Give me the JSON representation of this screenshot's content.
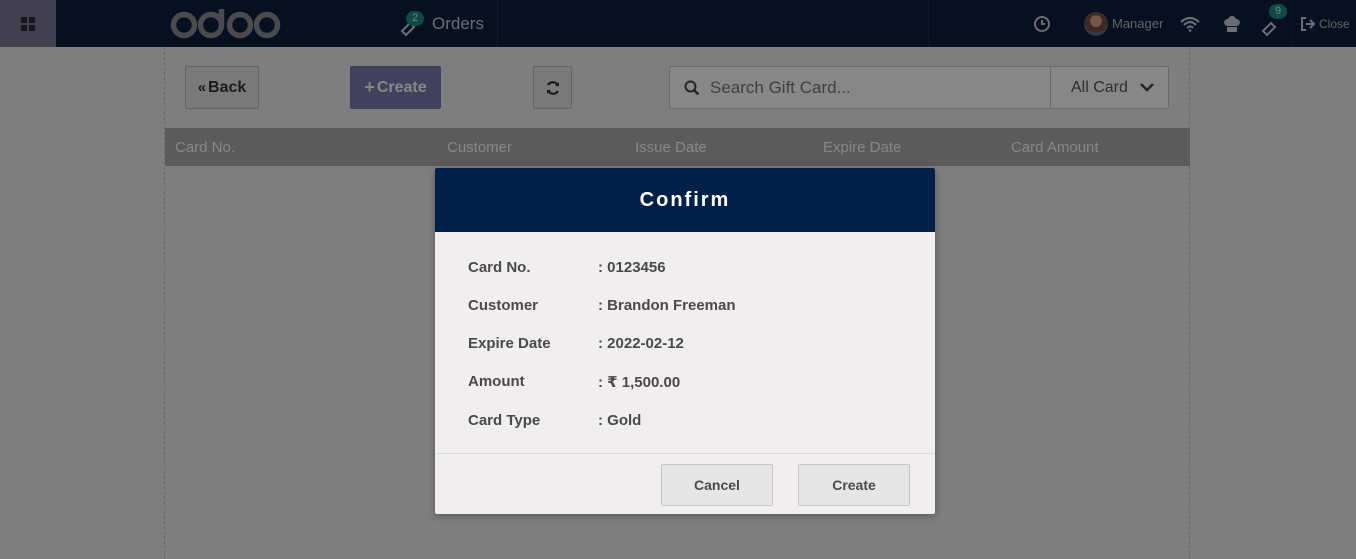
{
  "navbar": {
    "logo_text": "odoo",
    "orders_label": "Orders",
    "orders_badge": "2",
    "manager_label": "Manager",
    "gift_badge": "9",
    "close_label": "Close"
  },
  "toolbar": {
    "back_label": "Back",
    "create_label": "Create",
    "search_placeholder": "Search Gift Card...",
    "filter_selected": "All Card"
  },
  "table": {
    "columns": [
      "Card No.",
      "Customer",
      "Issue Date",
      "Expire Date",
      "Card Amount"
    ]
  },
  "dialog": {
    "title": "Confirm",
    "rows": [
      {
        "label": "Card No.",
        "value": ": 0123456"
      },
      {
        "label": "Customer",
        "value": ": Brandon Freeman"
      },
      {
        "label": "Expire Date",
        "value": ": 2022-02-12"
      },
      {
        "label": "Amount",
        "value": ": ₹ 1,500.00"
      },
      {
        "label": "Card Type",
        "value": ": Gold"
      }
    ],
    "cancel_label": "Cancel",
    "create_label": "Create"
  },
  "colors": {
    "navbar": "#0c1f3d",
    "dialog_header": "#012048",
    "create_button": "#7c7bad",
    "badge": "#1d8b80"
  }
}
